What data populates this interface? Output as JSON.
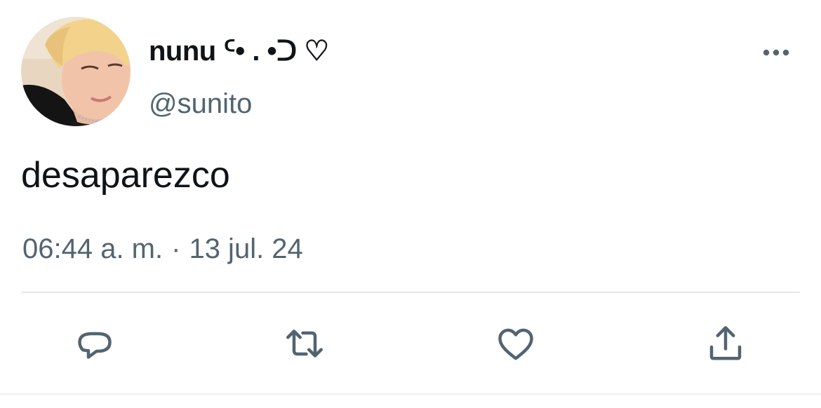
{
  "user": {
    "display_name": "nunu ᑦ• . •ᑐ ♡",
    "handle": "@sunito"
  },
  "tweet": {
    "text": "desaparezco",
    "time": "06:44 a. m.",
    "separator": "·",
    "date": "13 jul. 24"
  },
  "icons": {
    "more": "more-horizontal-icon",
    "reply": "reply-icon",
    "retweet": "retweet-icon",
    "like": "heart-icon",
    "share": "share-icon"
  },
  "colors": {
    "text_primary": "#0f1419",
    "text_secondary": "#536471",
    "divider": "#e4e8eb"
  }
}
